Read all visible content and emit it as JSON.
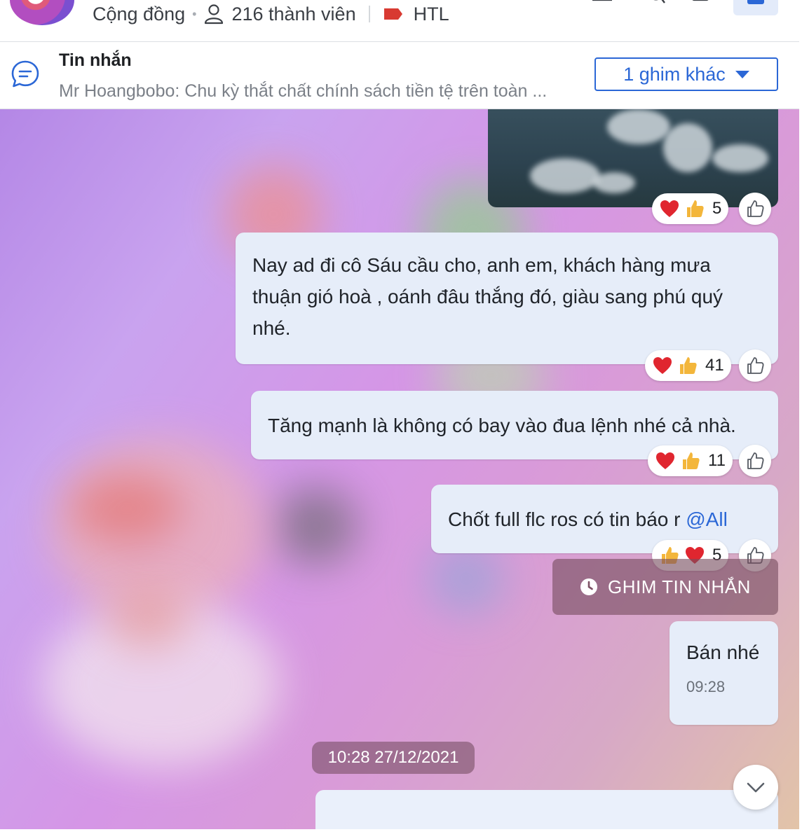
{
  "header": {
    "community_label": "Cộng đồng",
    "members": "216 thành viên",
    "tag_label": "HTL"
  },
  "pinned": {
    "title": "Tin nhắn",
    "preview": "Mr Hoangbobo: Chu kỳ thắt chất chính sách tiền tệ trên toàn ...",
    "more_label": "1 ghim khác"
  },
  "messages": [
    {
      "text": "Nay ad đi cô Sáu cầu cho, anh em, khách hàng mưa thuận gió hoà , oánh đâu thắng đó, giàu sang phú quý nhé.",
      "reaction_count": "41"
    },
    {
      "text": "Tăng mạnh là không có bay vào đua lệnh nhé cả nhà.",
      "reaction_count": "11"
    },
    {
      "text": "Chốt full flc ros có tin báo r ",
      "mention": "@All",
      "reaction_count": "5"
    },
    {
      "text": "Bán nhé",
      "time": "09:28"
    }
  ],
  "image_reaction_count": "5",
  "pin_notice": "GHIM TIN NHẮN",
  "date_separator": "10:28 27/12/2021",
  "colors": {
    "accent": "#2b67d6",
    "bubble": "#e6edf9",
    "heart": "#e0262f",
    "thumb": "#f3b63b"
  }
}
